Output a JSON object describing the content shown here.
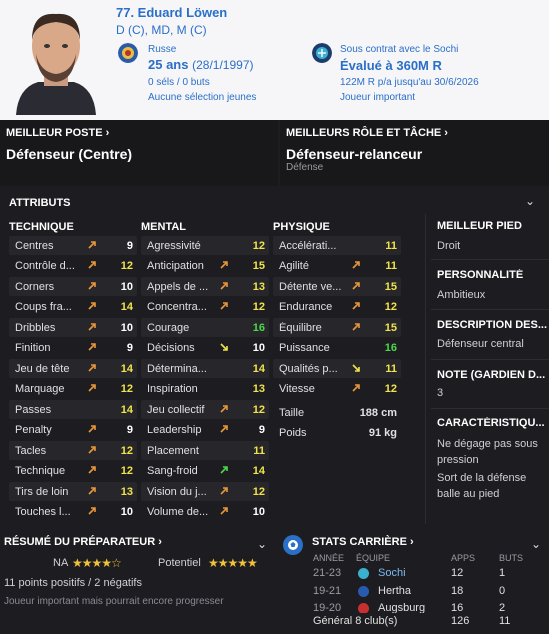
{
  "player": {
    "name": "77. Eduard Löwen",
    "positions": "D (C), MD, M (C)",
    "nationality": "Russe",
    "age": "25 ans",
    "birth": "(28/1/1997)",
    "caps": "0 séls / 0 buts",
    "youth": "Aucune sélection jeunes",
    "contract": "Sous contrat avec le Sochi",
    "value": "Évalué à 360M R",
    "wage": "122M R p/a jusqu'au 30/6/2026",
    "status": "Joueur important"
  },
  "best_position": {
    "label": "MEILLEUR POSTE",
    "value": "Défenseur (Centre)"
  },
  "best_role": {
    "label": "MEILLEURS RÔLE ET TÂCHE",
    "value": "Défenseur-relanceur",
    "duty": "Défense"
  },
  "attributes": {
    "title": "ATTRIBUTS",
    "technique_title": "TECHNIQUE",
    "mental_title": "MENTAL",
    "physique_title": "PHYSIQUE",
    "technique": [
      {
        "name": "Centres",
        "value": "9",
        "arrow": "up"
      },
      {
        "name": "Contrôle d...",
        "value": "12",
        "arrow": "up"
      },
      {
        "name": "Corners",
        "value": "10",
        "arrow": "up"
      },
      {
        "name": "Coups fra...",
        "value": "14",
        "arrow": "up"
      },
      {
        "name": "Dribbles",
        "value": "10",
        "arrow": "up"
      },
      {
        "name": "Finition",
        "value": "9",
        "arrow": "up"
      },
      {
        "name": "Jeu de tête",
        "value": "14",
        "arrow": "up"
      },
      {
        "name": "Marquage",
        "value": "12",
        "arrow": "up"
      },
      {
        "name": "Passes",
        "value": "14",
        "arrow": "none"
      },
      {
        "name": "Penalty",
        "value": "9",
        "arrow": "up"
      },
      {
        "name": "Tacles",
        "value": "12",
        "arrow": "up"
      },
      {
        "name": "Technique",
        "value": "12",
        "arrow": "up"
      },
      {
        "name": "Tirs de loin",
        "value": "13",
        "arrow": "up"
      },
      {
        "name": "Touches l...",
        "value": "10",
        "arrow": "up"
      }
    ],
    "mental": [
      {
        "name": "Agressivité",
        "value": "12",
        "arrow": "none"
      },
      {
        "name": "Anticipation",
        "value": "15",
        "arrow": "up"
      },
      {
        "name": "Appels de ...",
        "value": "13",
        "arrow": "up"
      },
      {
        "name": "Concentra...",
        "value": "12",
        "arrow": "up"
      },
      {
        "name": "Courage",
        "value": "16",
        "arrow": "none"
      },
      {
        "name": "Décisions",
        "value": "10",
        "arrow": "down"
      },
      {
        "name": "Détermina...",
        "value": "14",
        "arrow": "none"
      },
      {
        "name": "Inspiration",
        "value": "13",
        "arrow": "none"
      },
      {
        "name": "Jeu collectif",
        "value": "12",
        "arrow": "up"
      },
      {
        "name": "Leadership",
        "value": "9",
        "arrow": "up"
      },
      {
        "name": "Placement",
        "value": "11",
        "arrow": "none"
      },
      {
        "name": "Sang-froid",
        "value": "14",
        "arrow": "green"
      },
      {
        "name": "Vision du j...",
        "value": "12",
        "arrow": "up"
      },
      {
        "name": "Volume de...",
        "value": "10",
        "arrow": "up"
      }
    ],
    "physique": [
      {
        "name": "Accélérati...",
        "value": "11",
        "arrow": "none"
      },
      {
        "name": "Agilité",
        "value": "11",
        "arrow": "up"
      },
      {
        "name": "Détente ve...",
        "value": "15",
        "arrow": "up"
      },
      {
        "name": "Endurance",
        "value": "12",
        "arrow": "up"
      },
      {
        "name": "Équilibre",
        "value": "15",
        "arrow": "up"
      },
      {
        "name": "Puissance",
        "value": "16",
        "arrow": "none"
      },
      {
        "name": "Qualités p...",
        "value": "11",
        "arrow": "down"
      },
      {
        "name": "Vitesse",
        "value": "12",
        "arrow": "up"
      }
    ],
    "height_label": "Taille",
    "height": "188 cm",
    "weight_label": "Poids",
    "weight": "91 kg"
  },
  "right_info": [
    {
      "label": "MEILLEUR PIED",
      "value": "Droit"
    },
    {
      "label": "PERSONNALITÉ",
      "value": "Ambitieux"
    },
    {
      "label": "DESCRIPTION DES...",
      "value": "Défenseur central"
    },
    {
      "label": "NOTE (GARDIEN D...",
      "value": "3"
    },
    {
      "label": "CARACTÉRISTIQU...",
      "value": "Ne dégage pas sous pression"
    },
    {
      "label": "",
      "value": "Sort de la défense balle au pied"
    }
  ],
  "coach": {
    "title": "RÉSUMÉ DU PRÉPARATEUR",
    "current_label": "NA",
    "current_stars": "★★★★☆",
    "potential_label": "Potentiel",
    "potential_stars": "★★★★★",
    "points": "11 points positifs / 2 négatifs",
    "summary": "Joueur important mais pourrait encore progresser"
  },
  "career": {
    "title": "STATS CARRIÈRE",
    "headers": {
      "season": "ANNÉE",
      "club": "ÉQUIPE",
      "apps": "APPS",
      "goals": "BUTS"
    },
    "rows": [
      {
        "season": "21-23",
        "club": "Sochi",
        "apps": "12",
        "goals": "1"
      },
      {
        "season": "19-21",
        "club": "Hertha",
        "apps": "18",
        "goals": "0"
      },
      {
        "season": "19-20",
        "club": "Augsburg",
        "apps": "16",
        "goals": "2"
      }
    ],
    "total_label": "Général",
    "total_clubs": "8 club(s)",
    "total_apps": "126",
    "total_goals": "11"
  },
  "colors": {
    "accent": "#2a6fc8",
    "val_normal": "#ffffff",
    "val_mid": "#f0e44a",
    "val_high": "#4bd84b",
    "arrow_up": "#e8963c",
    "arrow_down": "#f0e44a"
  }
}
